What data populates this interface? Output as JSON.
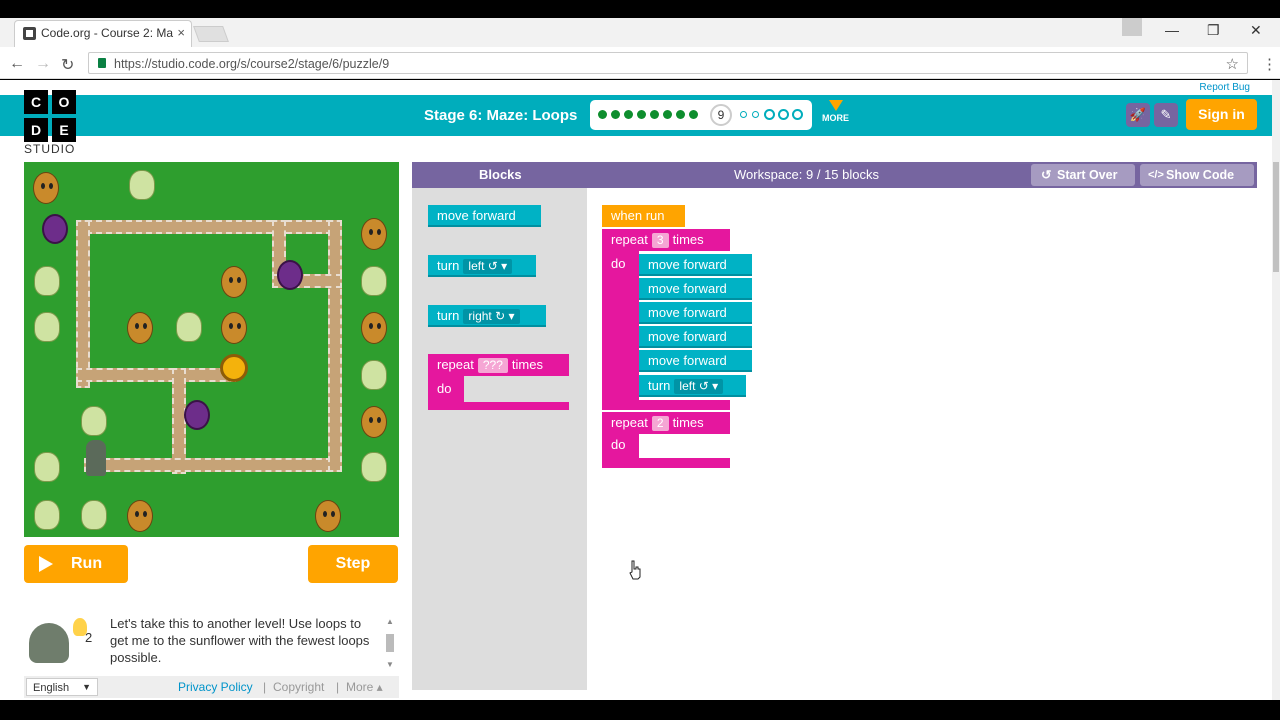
{
  "browser": {
    "tab_title": "Code.org - Course 2: Ma",
    "tab_close": "×",
    "url": "https://studio.code.org/s/course2/stage/6/puzzle/9",
    "back": "←",
    "forward": "→",
    "reload": "↻",
    "star": "☆",
    "menu": "⋮",
    "win_min": "—",
    "win_restore": "❐",
    "win_close": "✕"
  },
  "header": {
    "report_bug": "Report Bug",
    "logo_letters": [
      "C",
      "O",
      "D",
      "E"
    ],
    "logo_text": "STUDIO",
    "stage_title": "Stage 6: Maze: Loops",
    "current_puzzle": "9",
    "more_label": "MORE",
    "sign_in": "Sign in",
    "rocket_icon": "🚀",
    "pencil_icon": "✎",
    "progress": {
      "completed": 8,
      "current": 9,
      "small_after": 2,
      "remaining_after": 3
    }
  },
  "controls": {
    "run_label": "Run",
    "step_label": "Step"
  },
  "hint": {
    "text": "Let's take this to another level! Use loops to get me to the sunflower with the fewest loops possible.",
    "hint_count": "2",
    "up": "▲",
    "down": "▼"
  },
  "footer": {
    "language": "English",
    "lang_arrow": "▼",
    "privacy": "Privacy Policy",
    "sep1": "|",
    "copyright": "Copyright",
    "sep2": "|",
    "more": "More ▴"
  },
  "panel": {
    "blocks_title": "Blocks",
    "workspace_title": "Workspace: 9 / 15 blocks",
    "start_over": "Start Over",
    "show_code": "Show Code",
    "start_over_icon": "↺",
    "show_code_icon": "</>"
  },
  "toolbox": {
    "move_forward": "move forward",
    "turn_left_a": "turn",
    "turn_left_b": "left ↺ ▾",
    "turn_right_a": "turn",
    "turn_right_b": "right ↻ ▾",
    "repeat_a": "repeat",
    "repeat_count": "???",
    "repeat_b": "times",
    "repeat_do": "do"
  },
  "workspace": {
    "when_run": "when run",
    "repeat1_a": "repeat",
    "repeat1_count": "3",
    "repeat1_b": "times",
    "repeat1_do": "do",
    "moves": [
      "move forward",
      "move forward",
      "move forward",
      "move forward",
      "move forward"
    ],
    "turn_a": "turn",
    "turn_b": "left ↺ ▾",
    "repeat2_a": "repeat",
    "repeat2_count": "2",
    "repeat2_b": "times",
    "repeat2_do": "do"
  },
  "colors": {
    "header": "#00adbc",
    "accent_orange": "#ffa400",
    "panel_purple": "#7665a0",
    "block_teal": "#00b2c5",
    "block_pink": "#e5179e",
    "maze_green": "#2e9e2e",
    "link_blue": "#0094ca"
  }
}
